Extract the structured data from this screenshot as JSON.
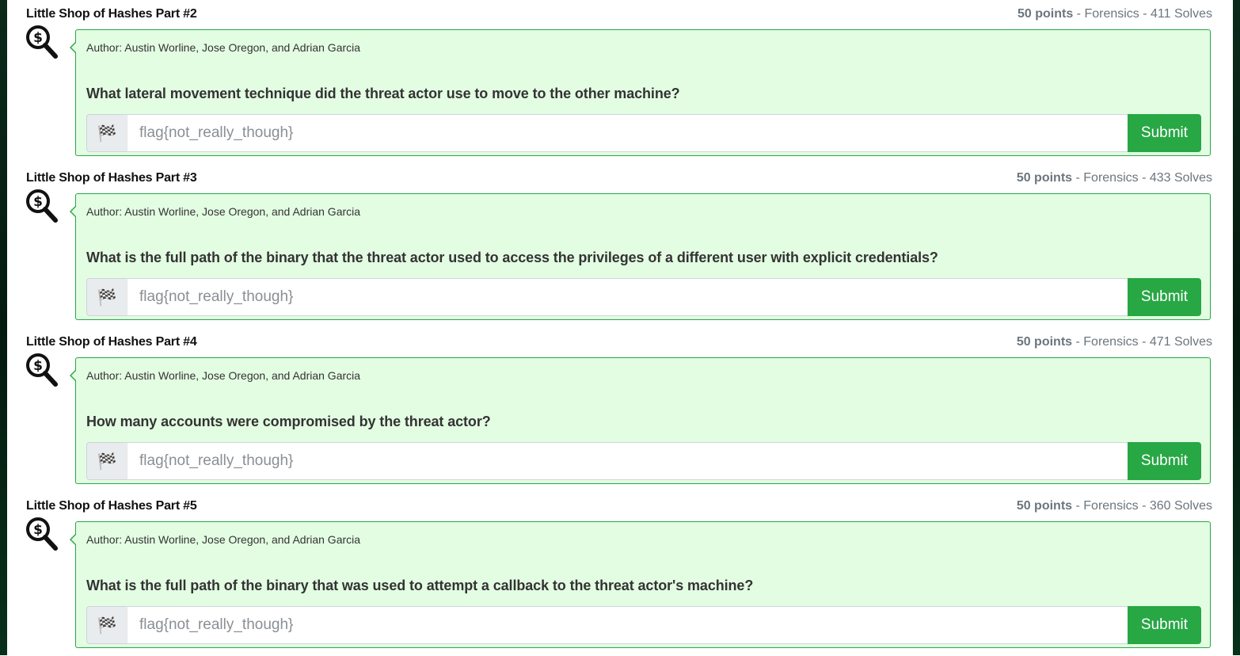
{
  "placeholder": "flag{not_really_though}",
  "submit_label": "Submit",
  "flag_icon": "checkered-flag-icon",
  "category_icon": "dollar-magnifier-icon",
  "colors": {
    "accent": "#28a745",
    "card_bg": "#e3fde3"
  },
  "challenges": [
    {
      "title": "Little Shop of Hashes Part #2",
      "points": "50 points",
      "meta": " - Forensics - 411 Solves",
      "author": "Author: Austin Worline, Jose Oregon, and Adrian Garcia",
      "question": "What lateral movement technique did the threat actor use to move to the other machine?"
    },
    {
      "title": "Little Shop of Hashes Part #3",
      "points": "50 points",
      "meta": " - Forensics - 433 Solves",
      "author": "Author: Austin Worline, Jose Oregon, and Adrian Garcia",
      "question": "What is the full path of the binary that the threat actor used to access the privileges of a different user with explicit credentials?"
    },
    {
      "title": "Little Shop of Hashes Part #4",
      "points": "50 points",
      "meta": " - Forensics - 471 Solves",
      "author": "Author: Austin Worline, Jose Oregon, and Adrian Garcia",
      "question": "How many accounts were compromised by the threat actor?"
    },
    {
      "title": "Little Shop of Hashes Part #5",
      "points": "50 points",
      "meta": " - Forensics - 360 Solves",
      "author": "Author: Austin Worline, Jose Oregon, and Adrian Garcia",
      "question": "What is the full path of the binary that was used to attempt a callback to the threat actor's machine?"
    }
  ]
}
